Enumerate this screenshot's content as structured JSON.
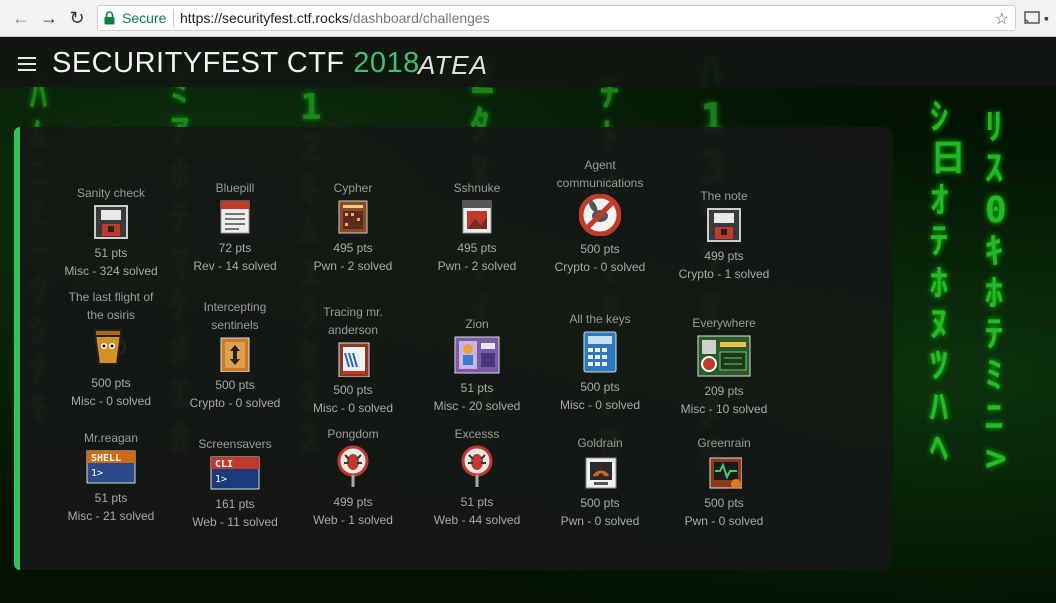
{
  "browser": {
    "secure_label": "Secure",
    "url_host": "https://securityfest.ctf.rocks",
    "url_path": "/dashboard/challenges"
  },
  "header": {
    "title_main": "SECURITYFEST CTF",
    "title_year": "2018",
    "sponsor": "ATEA"
  },
  "challenges": [
    {
      "name_lines": [
        "Sanity check"
      ],
      "points": "51 pts",
      "meta": "Misc - 324 solved",
      "icon": "floppy-disk-icon"
    },
    {
      "name_lines": [
        "Bluepill"
      ],
      "points": "72 pts",
      "meta": "Rev - 14 solved",
      "icon": "text-document-icon"
    },
    {
      "name_lines": [
        "Cypher"
      ],
      "points": "495 pts",
      "meta": "Pwn - 2 solved",
      "icon": "binary-document-icon"
    },
    {
      "name_lines": [
        "Sshnuke"
      ],
      "points": "495 pts",
      "meta": "Pwn - 2 solved",
      "icon": "image-document-icon"
    },
    {
      "name_lines": [
        "Agent",
        "communications"
      ],
      "points": "500 pts",
      "meta": "Crypto - 0 solved",
      "icon": "no-entry-bunny-icon"
    },
    {
      "name_lines": [
        "The note"
      ],
      "points": "499 pts",
      "meta": "Crypto - 1 solved",
      "icon": "floppy-disk-icon"
    },
    {
      "name_lines": [
        "The last flight of",
        "the osiris"
      ],
      "points": "500 pts",
      "meta": "Misc - 0 solved",
      "icon": "bucket-character-icon"
    },
    {
      "name_lines": [
        "Intercepting",
        "sentinels"
      ],
      "points": "500 pts",
      "meta": "Crypto - 0 solved",
      "icon": "resize-arrow-icon"
    },
    {
      "name_lines": [
        "Tracing mr.",
        "anderson"
      ],
      "points": "500 pts",
      "meta": "Misc - 0 solved",
      "icon": "notebook-icon"
    },
    {
      "name_lines": [
        "Zion"
      ],
      "points": "51 pts",
      "meta": "Misc - 20 solved",
      "icon": "robot-map-icon"
    },
    {
      "name_lines": [
        "All the keys"
      ],
      "points": "500 pts",
      "meta": "Misc - 0 solved",
      "icon": "calculator-icon"
    },
    {
      "name_lines": [
        "Everywhere"
      ],
      "points": "209 pts",
      "meta": "Misc - 10 solved",
      "icon": "circuit-board-icon"
    },
    {
      "name_lines": [
        "Mr.reagan"
      ],
      "points": "51 pts",
      "meta": "Misc - 21 solved",
      "icon": "shell-terminal-icon"
    },
    {
      "name_lines": [
        "Screensavers"
      ],
      "points": "161 pts",
      "meta": "Web - 11 solved",
      "icon": "cli-terminal-icon"
    },
    {
      "name_lines": [
        "Pongdom"
      ],
      "points": "499 pts",
      "meta": "Web - 1 solved",
      "icon": "bug-pin-icon"
    },
    {
      "name_lines": [
        "Excesss"
      ],
      "points": "51 pts",
      "meta": "Web - 44 solved",
      "icon": "bug-pin-icon"
    },
    {
      "name_lines": [
        "Goldrain"
      ],
      "points": "500 pts",
      "meta": "Pwn - 0 solved",
      "icon": "wifi-card-icon"
    },
    {
      "name_lines": [
        "Greenrain"
      ],
      "points": "500 pts",
      "meta": "Pwn - 0 solved",
      "icon": "heartbeat-card-icon"
    }
  ],
  "colors": {
    "accent_green": "#2fc45f",
    "year_green": "#3fbf6f"
  }
}
